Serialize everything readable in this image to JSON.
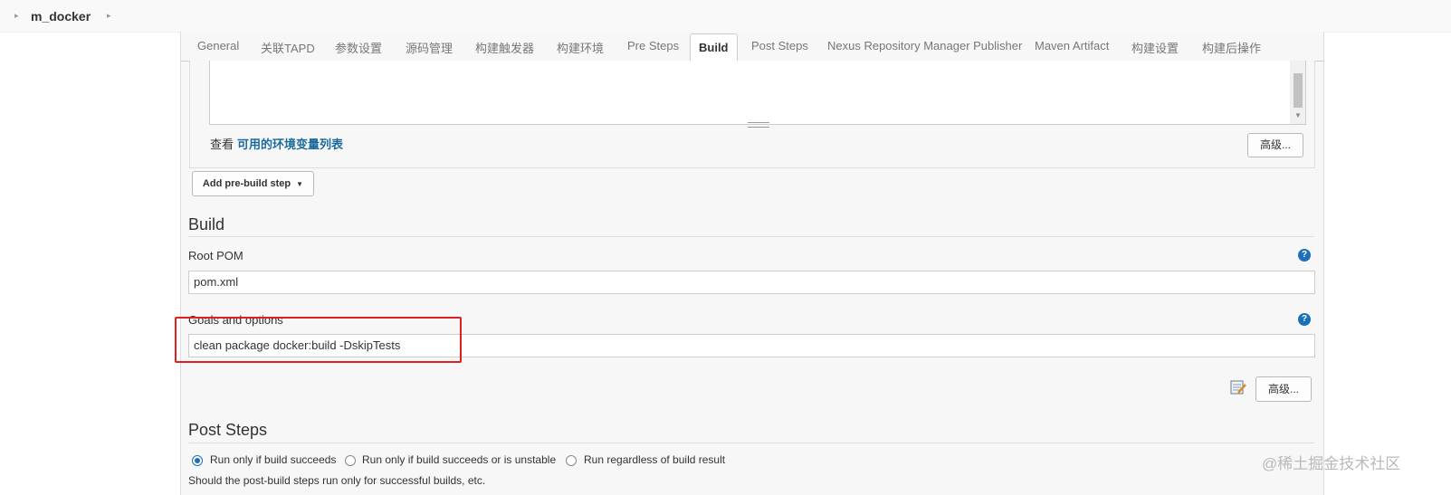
{
  "breadcrumb": {
    "job": "m_docker"
  },
  "tabs": [
    {
      "label": "General"
    },
    {
      "label": "关联TAPD"
    },
    {
      "label": "参数设置"
    },
    {
      "label": "源码管理"
    },
    {
      "label": "构建触发器"
    },
    {
      "label": "构建环境"
    },
    {
      "label": "Pre Steps"
    },
    {
      "label": "Build"
    },
    {
      "label": "Post Steps"
    },
    {
      "label": "Nexus Repository Manager Publisher"
    },
    {
      "label": "Maven Artifact"
    },
    {
      "label": "构建设置"
    },
    {
      "label": "构建后操作"
    }
  ],
  "active_tab": "Build",
  "pre_steps": {
    "env_prefix": "查看",
    "env_link": "可用的环境变量列表",
    "advanced_button": "高级...",
    "add_step_button": "Add pre-build step"
  },
  "build": {
    "title": "Build",
    "root_pom_label": "Root POM",
    "root_pom_value": "pom.xml",
    "goals_label": "Goals and options",
    "goals_value": "clean package docker:build -DskipTests",
    "advanced_button": "高级..."
  },
  "post_steps": {
    "title": "Post Steps",
    "options": [
      {
        "label": "Run only if build succeeds",
        "checked": true
      },
      {
        "label": "Run only if build succeeds or is unstable",
        "checked": false
      },
      {
        "label": "Run regardless of build result",
        "checked": false
      }
    ],
    "description": "Should the post-build steps run only for successful builds, etc."
  },
  "watermark": "@稀土掘金技术社区",
  "colors": {
    "accent": "#1d70b8",
    "highlight": "#e02020",
    "link": "#1b6a9c"
  }
}
